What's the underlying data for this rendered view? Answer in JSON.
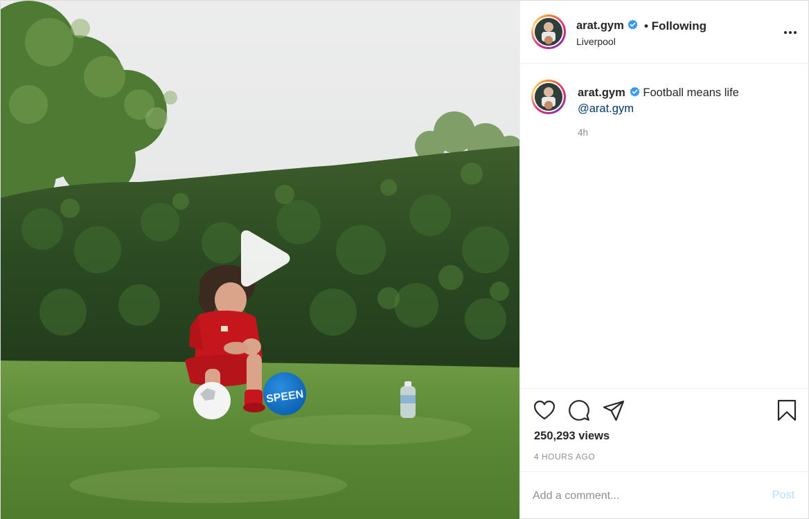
{
  "post": {
    "username": "arat.gym",
    "verified": true,
    "follow_status": "• Following",
    "location": "Liverpool",
    "caption_text": "Football means life",
    "caption_mention": "@arat.gym",
    "caption_time": "4h",
    "views": "250,293 views",
    "posted_ago": "4 HOURS AGO",
    "ball_text": "SPEEN"
  },
  "comment": {
    "placeholder": "Add a comment...",
    "post_label": "Post"
  },
  "icons": {
    "play": "play-icon",
    "more": "more-options-icon",
    "like": "heart-icon",
    "comment": "comment-icon",
    "share": "paper-plane-icon",
    "save": "bookmark-icon",
    "verified": "verified-badge-icon"
  },
  "colors": {
    "verified_blue": "#3897f0",
    "post_button_disabled": "#b2dffc",
    "mention": "#00376b",
    "muted": "#8e8e8e"
  }
}
